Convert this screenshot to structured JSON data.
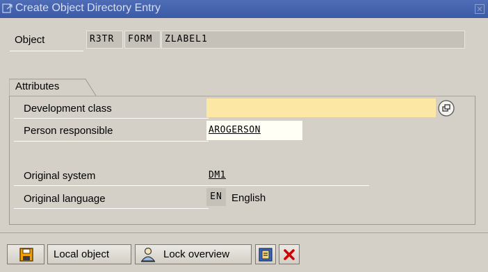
{
  "window": {
    "title": "Create Object Directory Entry"
  },
  "object": {
    "label": "Object",
    "pgmid": "R3TR",
    "type": "FORM",
    "name": "ZLABEL1"
  },
  "attributes": {
    "tab_label": "Attributes",
    "development_class": {
      "label": "Development class",
      "value": ""
    },
    "person_responsible": {
      "label": "Person responsible",
      "value": "AROGERSON"
    },
    "original_system": {
      "label": "Original system",
      "value": "DM1"
    },
    "original_language": {
      "label": "Original language",
      "code": "EN",
      "text": "English"
    }
  },
  "toolbar": {
    "local_object_label": "Local object",
    "lock_overview_label": "Lock overview"
  },
  "colors": {
    "title_bar": "#3b5aa6",
    "required_field": "#fce8a4",
    "cancel_red": "#d00000"
  }
}
